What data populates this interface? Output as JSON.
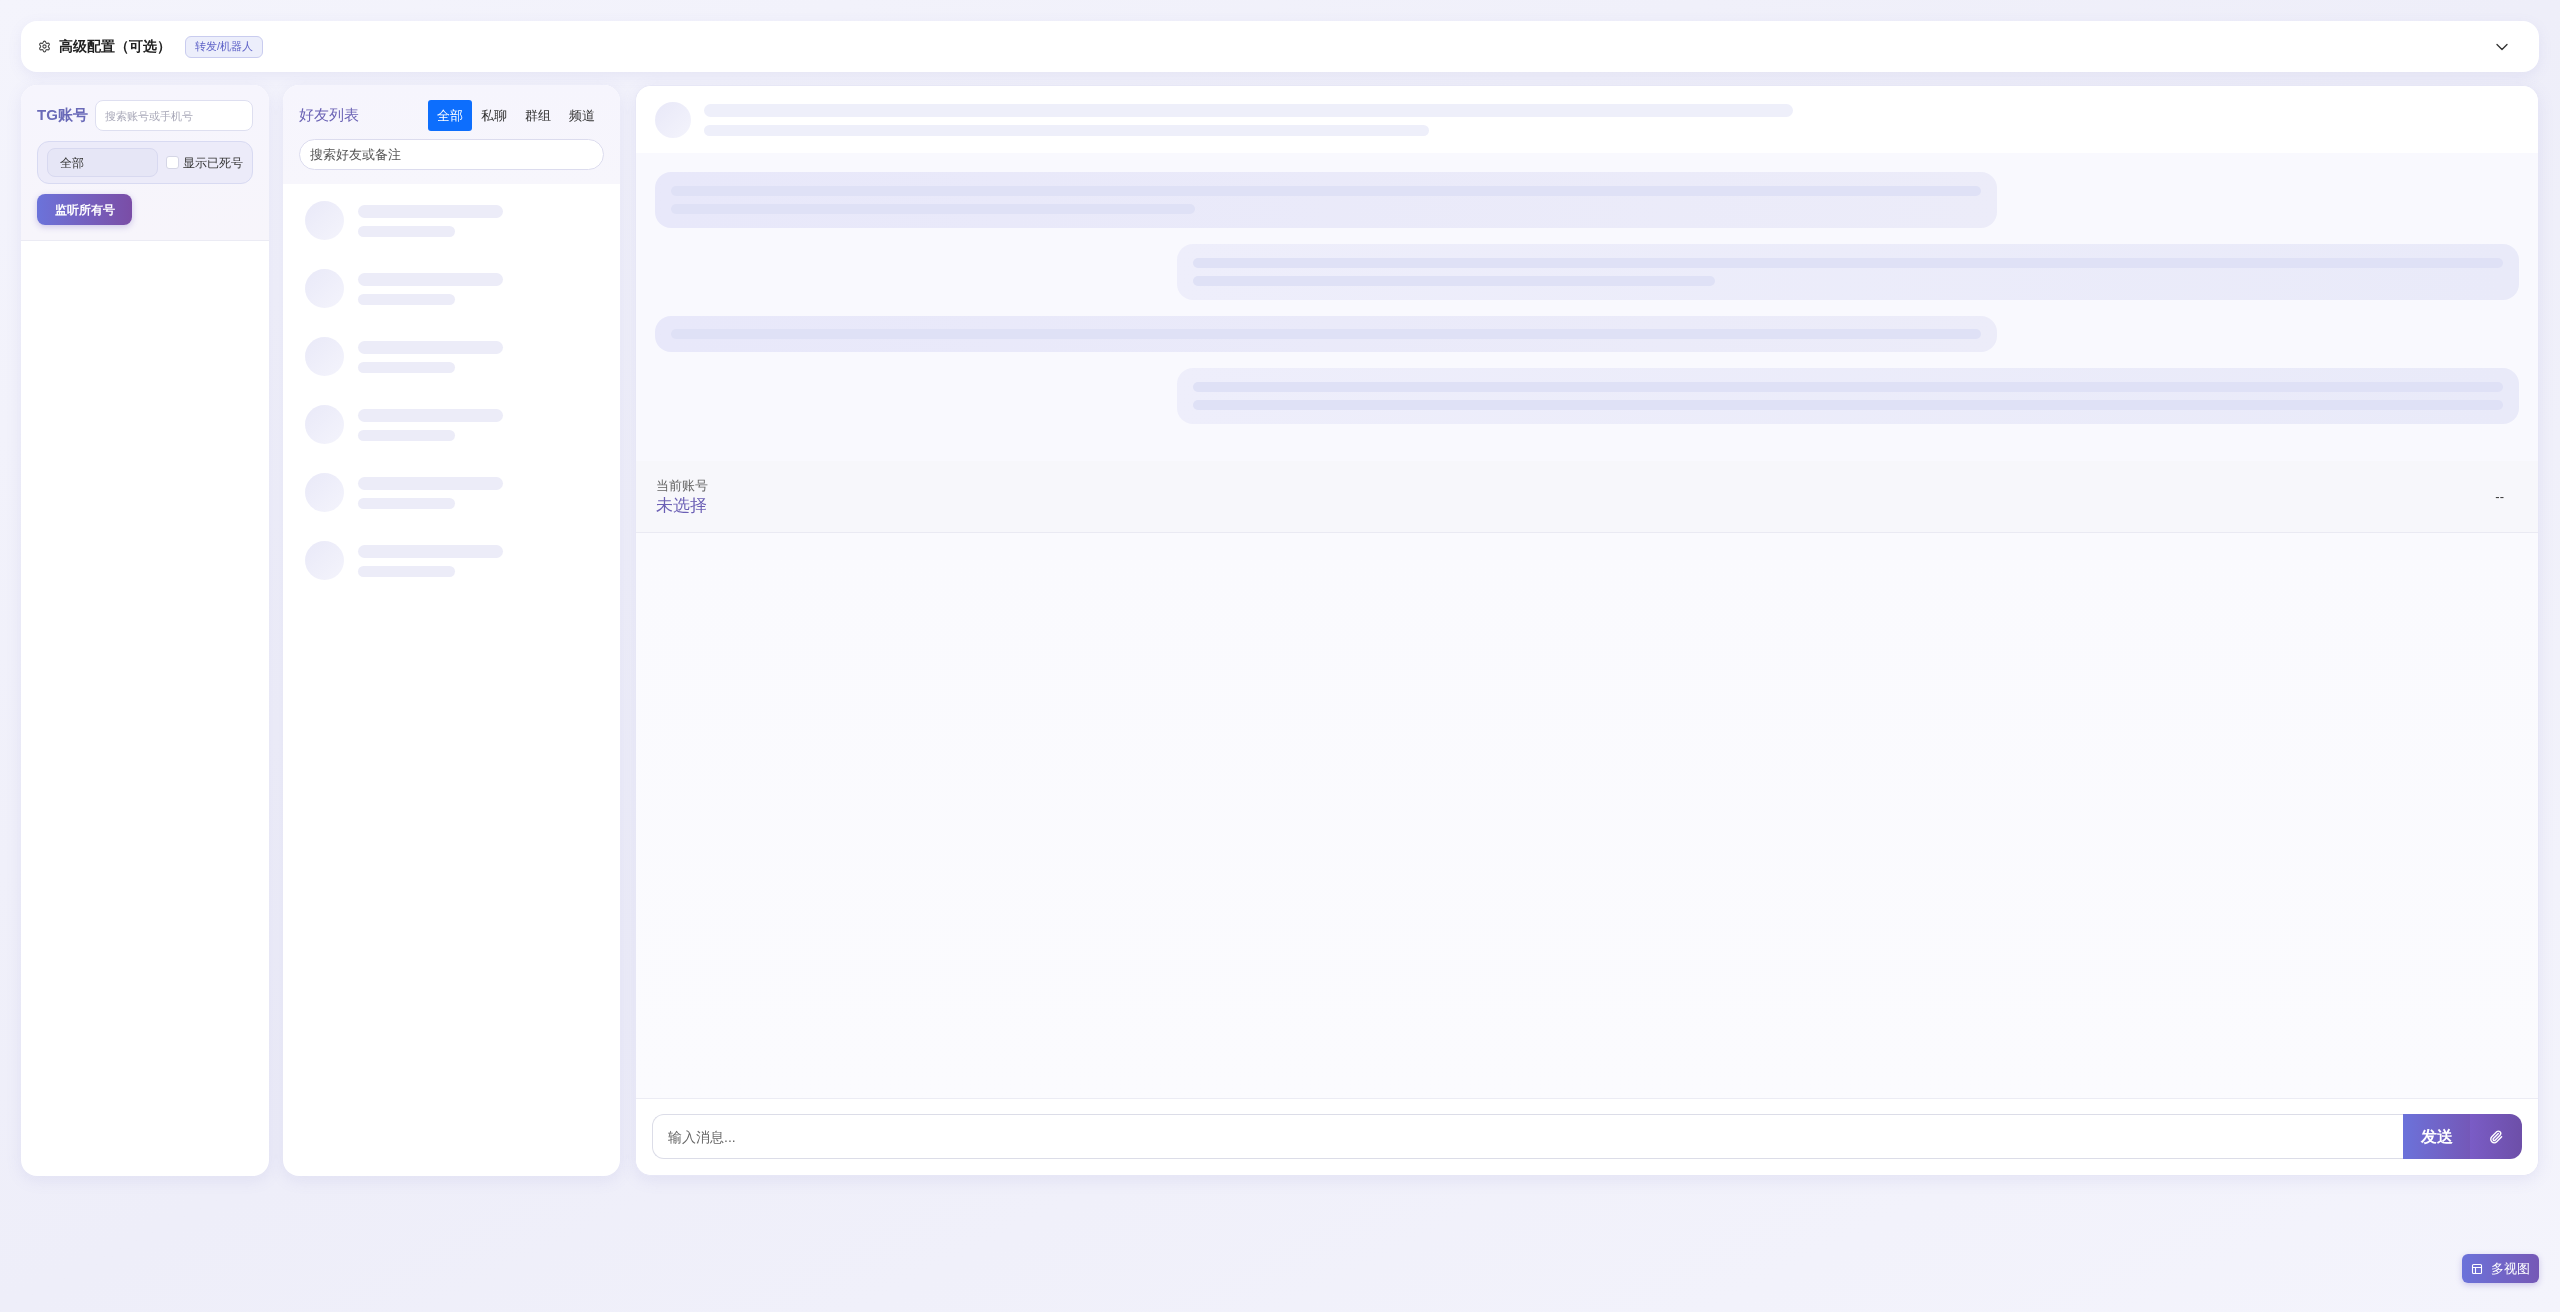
{
  "config": {
    "title": "高级配置（可选）",
    "badge": "转发/机器人",
    "expanded": false
  },
  "accounts": {
    "title": "TG账号",
    "search": {
      "placeholder": "搜索账号或手机号"
    },
    "filter": {
      "value": "全部"
    },
    "show_dead": {
      "label": "显示已死号",
      "checked": false
    },
    "monitor_button": "监听所有号"
  },
  "friends": {
    "title": "好友列表",
    "tabs": [
      {
        "label": "全部",
        "selected": true
      },
      {
        "label": "私聊",
        "selected": false
      },
      {
        "label": "群组",
        "selected": false
      },
      {
        "label": "频道",
        "selected": false
      }
    ],
    "search": {
      "placeholder": "搜索好友或备注"
    },
    "loading": true
  },
  "chat": {
    "loading": true,
    "account": {
      "label": "当前账号",
      "value": "未选择",
      "status": "--"
    },
    "input": {
      "placeholder": "输入消息..."
    },
    "send_button": "发送"
  },
  "multi_view_button": "多视图"
}
